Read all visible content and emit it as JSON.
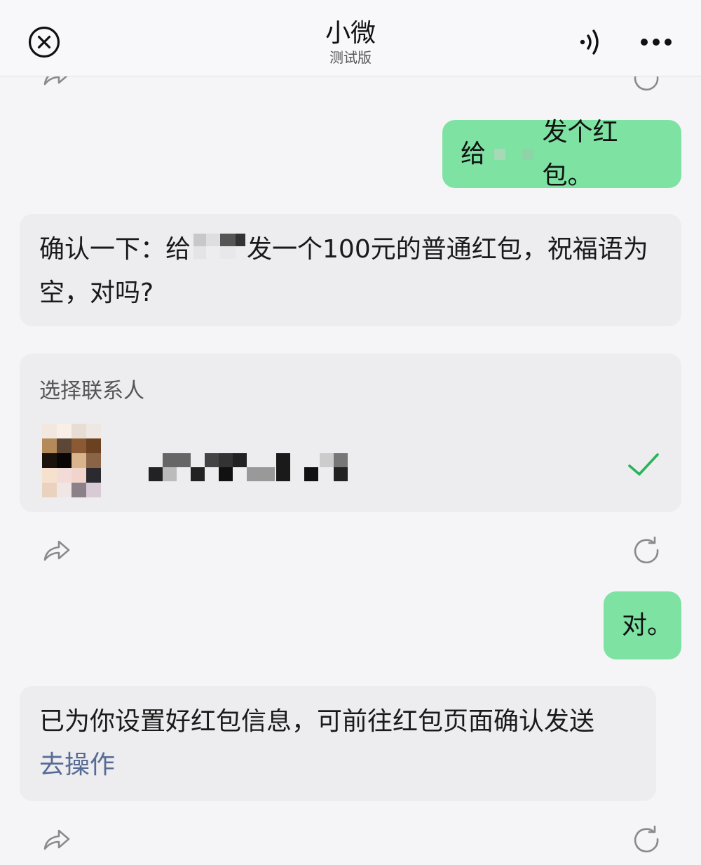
{
  "header": {
    "title": "小微",
    "subtitle": "测试版",
    "left_icon": "close-circle-icon",
    "voice_icon": "speaker-volume-icon",
    "more_icon": "more-dots-icon"
  },
  "messages": {
    "user1": {
      "prefix": "给",
      "suffix": "发个红包。"
    },
    "bot1": {
      "prefix": "确认一下：给",
      "suffix": "发一个100元的普通红包，祝福语为空，对吗?"
    },
    "contact_card": {
      "title": "选择联系人",
      "selected_icon": "check-icon"
    },
    "user2": {
      "text": "对。"
    },
    "bot2": {
      "text": "已为你设置好红包信息，可前往红包页面确认发送",
      "link": "去操作"
    }
  },
  "actions": {
    "share_icon": "share-icon",
    "regenerate_icon": "refresh-icon"
  },
  "colors": {
    "user_bubble": "#7ee2a3",
    "bot_bubble": "#ededef",
    "link": "#576b95",
    "check": "#2bb35a"
  }
}
